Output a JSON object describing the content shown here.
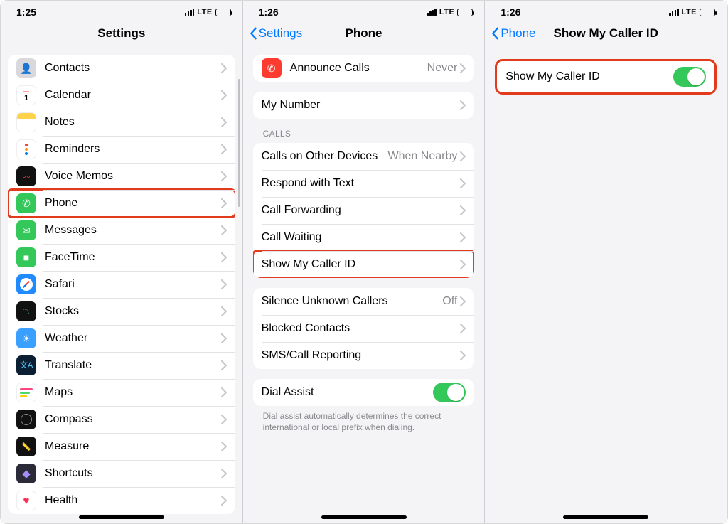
{
  "statusbar": {
    "time1": "1:25",
    "time2": "1:26",
    "time3": "1:26",
    "network": "LTE"
  },
  "panel1": {
    "title": "Settings",
    "items": [
      {
        "label": "Contacts",
        "icon": "contacts"
      },
      {
        "label": "Calendar",
        "icon": "calendar"
      },
      {
        "label": "Notes",
        "icon": "notes"
      },
      {
        "label": "Reminders",
        "icon": "reminders"
      },
      {
        "label": "Voice Memos",
        "icon": "voicememos"
      },
      {
        "label": "Phone",
        "icon": "phone",
        "highlight": true
      },
      {
        "label": "Messages",
        "icon": "messages"
      },
      {
        "label": "FaceTime",
        "icon": "facetime"
      },
      {
        "label": "Safari",
        "icon": "safari"
      },
      {
        "label": "Stocks",
        "icon": "stocks"
      },
      {
        "label": "Weather",
        "icon": "weather"
      },
      {
        "label": "Translate",
        "icon": "translate"
      },
      {
        "label": "Maps",
        "icon": "maps"
      },
      {
        "label": "Compass",
        "icon": "compass"
      },
      {
        "label": "Measure",
        "icon": "measure"
      },
      {
        "label": "Shortcuts",
        "icon": "shortcuts"
      },
      {
        "label": "Health",
        "icon": "health"
      }
    ]
  },
  "panel2": {
    "back": "Settings",
    "title": "Phone",
    "announce": {
      "label": "Announce Calls",
      "value": "Never"
    },
    "mynumber": {
      "label": "My Number"
    },
    "calls_header": "CALLS",
    "calls": [
      {
        "label": "Calls on Other Devices",
        "value": "When Nearby"
      },
      {
        "label": "Respond with Text"
      },
      {
        "label": "Call Forwarding"
      },
      {
        "label": "Call Waiting"
      },
      {
        "label": "Show My Caller ID",
        "highlight": true
      }
    ],
    "blocking": [
      {
        "label": "Silence Unknown Callers",
        "value": "Off"
      },
      {
        "label": "Blocked Contacts"
      },
      {
        "label": "SMS/Call Reporting"
      }
    ],
    "dial_assist": {
      "label": "Dial Assist",
      "on": true
    },
    "dial_assist_footer": "Dial assist automatically determines the correct international or local prefix when dialing."
  },
  "panel3": {
    "back": "Phone",
    "title": "Show My Caller ID",
    "toggle": {
      "label": "Show My Caller ID",
      "on": true
    }
  }
}
